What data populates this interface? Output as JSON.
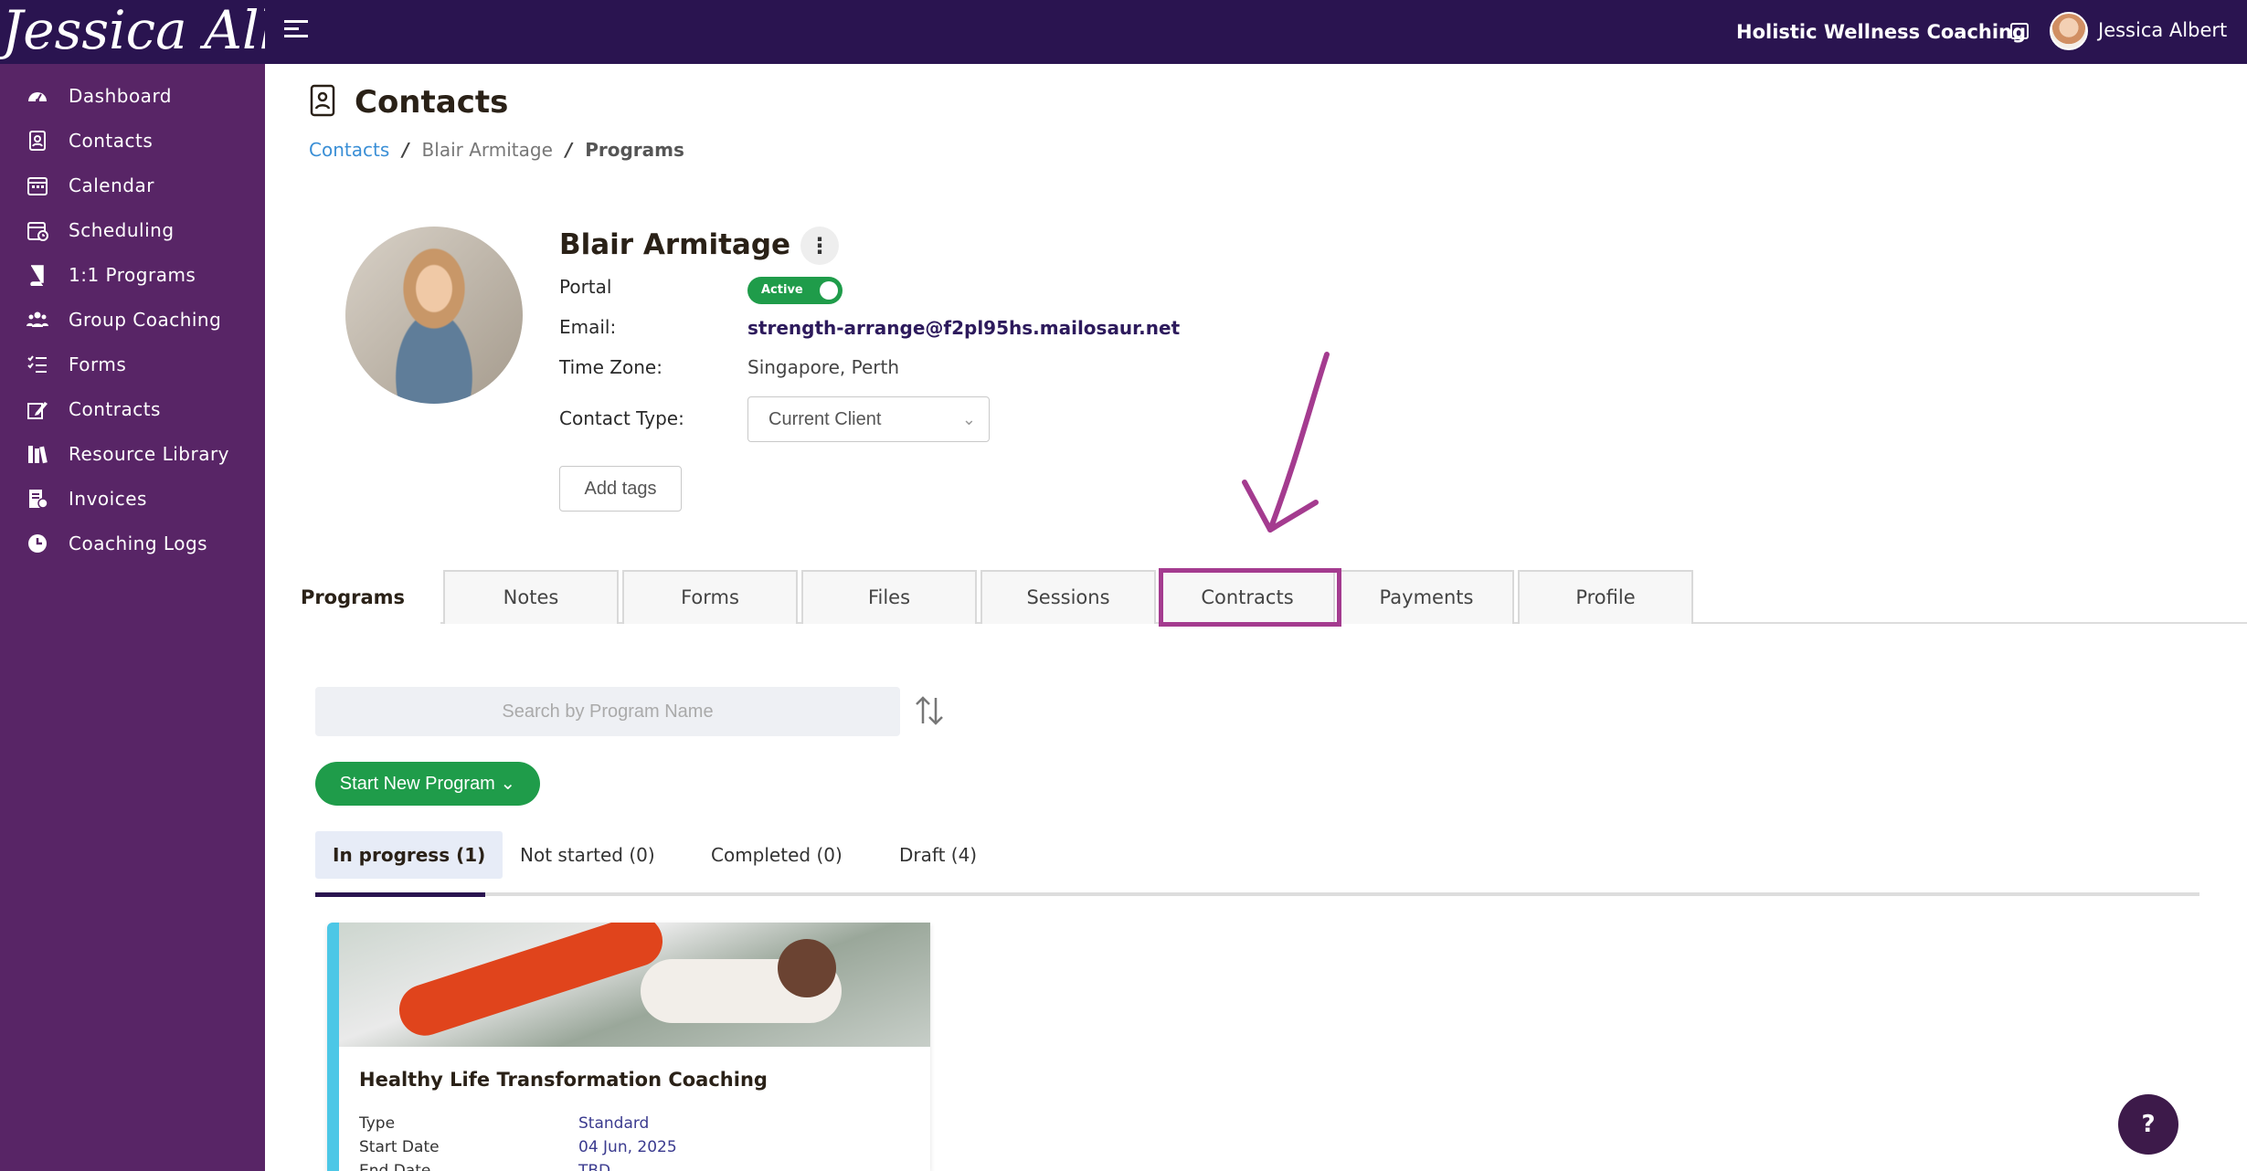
{
  "brand": {
    "name": "Jessica Albert"
  },
  "topbar": {
    "company": "Holistic Wellness Coaching",
    "user_name": "Jessica Albert"
  },
  "sidebar": {
    "items": [
      {
        "label": "Dashboard",
        "icon": "dashboard-icon"
      },
      {
        "label": "Contacts",
        "icon": "contacts-icon"
      },
      {
        "label": "Calendar",
        "icon": "calendar-icon"
      },
      {
        "label": "Scheduling",
        "icon": "scheduling-icon"
      },
      {
        "label": "1:1 Programs",
        "icon": "book-icon"
      },
      {
        "label": "Group Coaching",
        "icon": "group-icon"
      },
      {
        "label": "Forms",
        "icon": "forms-icon"
      },
      {
        "label": "Contracts",
        "icon": "contract-icon"
      },
      {
        "label": "Resource Library",
        "icon": "library-icon"
      },
      {
        "label": "Invoices",
        "icon": "invoice-icon"
      },
      {
        "label": "Coaching Logs",
        "icon": "clock-icon"
      }
    ]
  },
  "page": {
    "title": "Contacts"
  },
  "breadcrumb": {
    "root": "Contacts",
    "contact": "Blair Armitage",
    "current": "Programs",
    "separator": "/"
  },
  "contact": {
    "name": "Blair Armitage",
    "more_icon": "⋮",
    "portal_label": "Portal",
    "portal_status": "Active",
    "email_label": "Email:",
    "email": "strength-arrange@f2pl95hs.mailosaur.net",
    "timezone_label": "Time Zone:",
    "timezone": "Singapore, Perth",
    "type_label": "Contact Type:",
    "type_value": "Current Client",
    "add_tags": "Add tags"
  },
  "tabs": [
    {
      "label": "Programs",
      "active": true
    },
    {
      "label": "Notes"
    },
    {
      "label": "Forms"
    },
    {
      "label": "Files"
    },
    {
      "label": "Sessions"
    },
    {
      "label": "Contracts",
      "highlighted": true
    },
    {
      "label": "Payments"
    },
    {
      "label": "Profile"
    }
  ],
  "programs": {
    "search_placeholder": "Search by Program Name",
    "start_button": "Start New Program",
    "status_tabs": [
      {
        "label": "In progress (1)",
        "active": true
      },
      {
        "label": "Not started (0)"
      },
      {
        "label": "Completed (0)"
      },
      {
        "label": "Draft (4)"
      }
    ],
    "card": {
      "title": "Healthy Life Transformation Coaching",
      "type_label": "Type",
      "type_value": "Standard",
      "start_label": "Start Date",
      "start_value": "04 Jun, 2025",
      "end_label": "End Date",
      "end_value": "TBD"
    }
  },
  "help": {
    "label": "?"
  },
  "colors": {
    "topbar": "#2a1450",
    "sidebar": "#582566",
    "accent_green": "#1f9c4a",
    "highlight": "#a43b8f",
    "card_stripe": "#4cc7e6"
  }
}
